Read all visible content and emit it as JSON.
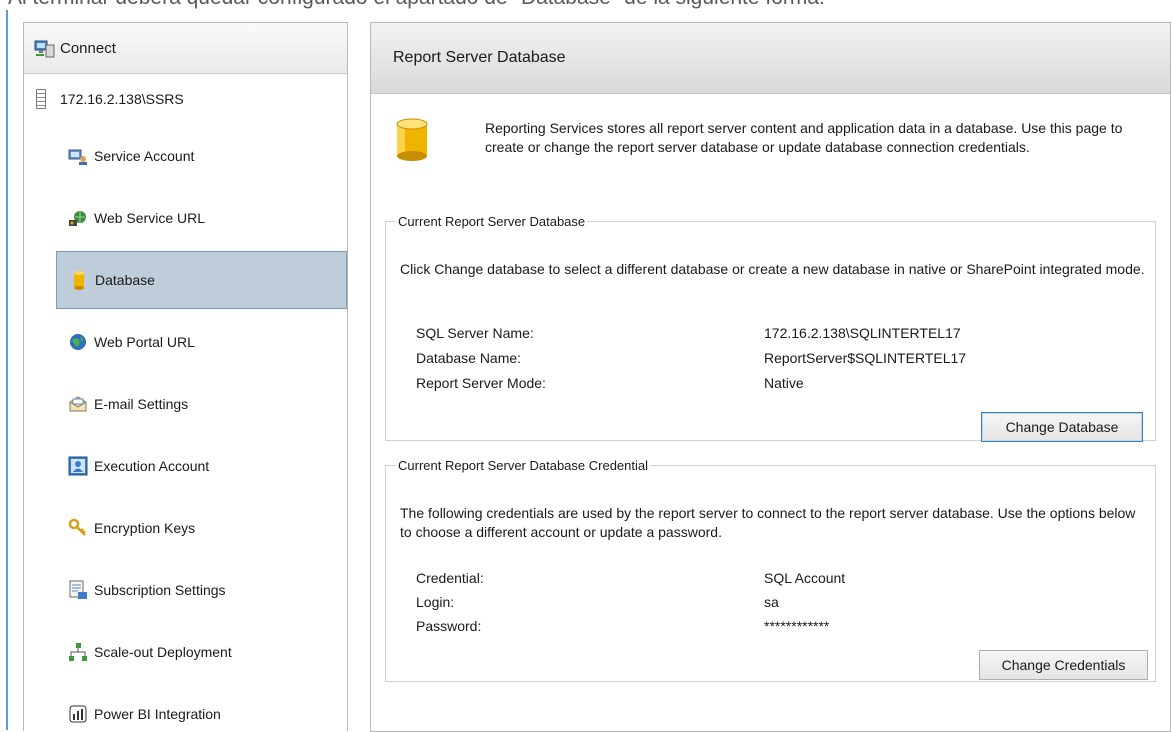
{
  "caption": "Al terminar deberá quedar configurado el apartado de \"Database\" de la siguiente forma:",
  "sidebar": {
    "connect_label": "Connect",
    "server": "172.16.2.138\\SSRS",
    "items": [
      {
        "label": "Service Account",
        "icon": "service-account-icon"
      },
      {
        "label": "Web Service URL",
        "icon": "web-service-url-icon"
      },
      {
        "label": "Database",
        "icon": "database-icon",
        "selected": true
      },
      {
        "label": "Web Portal URL",
        "icon": "web-portal-icon"
      },
      {
        "label": "E-mail Settings",
        "icon": "email-icon"
      },
      {
        "label": "Execution Account",
        "icon": "execution-account-icon"
      },
      {
        "label": "Encryption Keys",
        "icon": "encryption-keys-icon"
      },
      {
        "label": "Subscription Settings",
        "icon": "subscription-icon"
      },
      {
        "label": "Scale-out Deployment",
        "icon": "scale-out-icon"
      },
      {
        "label": "Power BI Integration",
        "icon": "power-bi-icon"
      }
    ]
  },
  "main": {
    "title": "Report Server Database",
    "intro": "Reporting Services stores all report server content and application data in a database. Use this page to create or change the report server database or update database connection credentials.",
    "current_db": {
      "legend": "Current Report Server Database",
      "description": "Click Change database to select a different database or create a new database in native or SharePoint integrated mode.",
      "sql_server_label": "SQL Server Name:",
      "sql_server_value": "172.16.2.138\\SQLINTERTEL17",
      "db_name_label": "Database Name:",
      "db_name_value": "ReportServer$SQLINTERTEL17",
      "mode_label": "Report Server Mode:",
      "mode_value": "Native",
      "button": "Change Database"
    },
    "credential": {
      "legend": "Current Report Server Database Credential",
      "description": "The following credentials are used by the report server to connect to the report server database. Use the options below to choose a different account or update a password.",
      "credential_label": "Credential:",
      "credential_value": "SQL Account",
      "login_label": "Login:",
      "login_value": "sa",
      "password_label": "Password:",
      "password_value": "************",
      "button": "Change Credentials"
    }
  },
  "colors": {
    "selected_bg": "#bfcddb",
    "selected_border": "#7a9abb",
    "database_gold": "#f0b400"
  }
}
